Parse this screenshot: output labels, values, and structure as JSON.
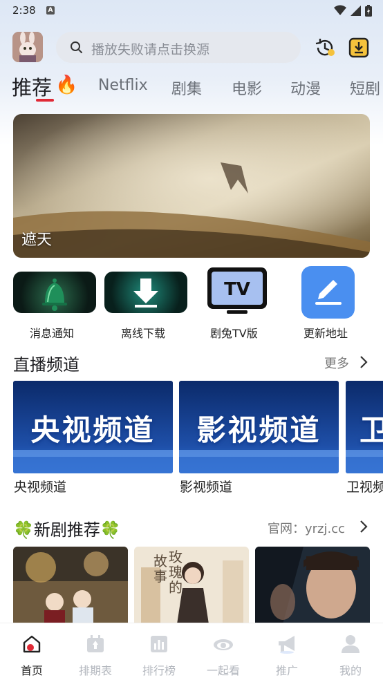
{
  "status_bar": {
    "time": "2:38",
    "notification_letter": "A"
  },
  "header": {
    "search_placeholder": "播放失败请点击换源"
  },
  "tabs": [
    {
      "label": "推荐",
      "active": true
    },
    {
      "label": "Netflix",
      "active": false
    },
    {
      "label": "剧集",
      "active": false
    },
    {
      "label": "电影",
      "active": false
    },
    {
      "label": "动漫",
      "active": false
    },
    {
      "label": "短剧",
      "active": false
    }
  ],
  "banner": {
    "title": "遮天"
  },
  "quick_entries": [
    {
      "label": "消息通知",
      "icon": "bell-icon"
    },
    {
      "label": "离线下载",
      "icon": "download-icon"
    },
    {
      "label": "剧兔TV版",
      "icon": "tv-icon"
    },
    {
      "label": "更新地址",
      "icon": "edit-icon"
    }
  ],
  "live_section": {
    "title": "直播频道",
    "more": "更多",
    "channels": [
      {
        "name": "央视频道",
        "card_text": "央视频道"
      },
      {
        "name": "影视频道",
        "card_text": "影视频道"
      },
      {
        "name": "卫视频道",
        "card_text": "卫视频道"
      }
    ]
  },
  "new_section": {
    "title": "🍀新剧推荐🍀",
    "site": "官网：yrzj.cc",
    "poster_texts": [
      "故",
      "玫",
      "事",
      "瑰",
      "的"
    ]
  },
  "bottom_nav": [
    {
      "label": "首页",
      "active": true
    },
    {
      "label": "排期表",
      "active": false
    },
    {
      "label": "排行榜",
      "active": false
    },
    {
      "label": "一起看",
      "active": false
    },
    {
      "label": "推广",
      "active": false
    },
    {
      "label": "我的",
      "active": false
    }
  ],
  "colors": {
    "accent": "#e02a36",
    "inactive": "#b2b6bd",
    "edit_tile": "#4a8ff0"
  }
}
